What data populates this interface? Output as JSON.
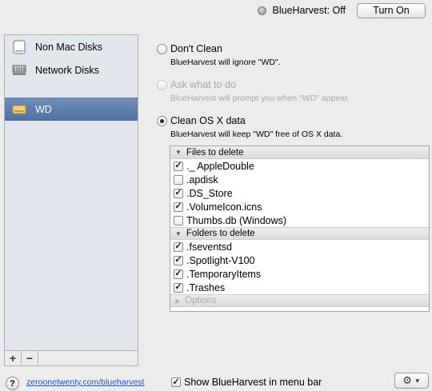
{
  "status": {
    "label": "BlueHarvest: Off",
    "button": "Turn On"
  },
  "sidebar": {
    "items": [
      {
        "label": "Non Mac Disks",
        "icon": "disk-icon"
      },
      {
        "label": "Network Disks",
        "icon": "network-icon"
      },
      {
        "label": "WD",
        "icon": "drive-icon",
        "selected": true
      }
    ],
    "add_label": "+",
    "remove_label": "−"
  },
  "options": {
    "dont_clean": {
      "label": "Don't Clean",
      "desc": "BlueHarvest will ignore \"WD\"."
    },
    "ask": {
      "label": "Ask what to do",
      "desc": "BlueHarvest will prompt you when \"WD\" appear."
    },
    "clean": {
      "label": "Clean OS X data",
      "desc": "BlueHarvest will keep \"WD\" free of OS X data."
    }
  },
  "list": {
    "files_header": "Files to delete",
    "files": [
      {
        "name": "._ AppleDouble",
        "checked": true
      },
      {
        "name": ".apdisk",
        "checked": false
      },
      {
        "name": ".DS_Store",
        "checked": true
      },
      {
        "name": ".VolumeIcon.icns",
        "checked": true
      },
      {
        "name": "Thumbs.db (Windows)",
        "checked": false
      }
    ],
    "folders_header": "Folders to delete",
    "folders": [
      {
        "name": ".fseventsd",
        "checked": true
      },
      {
        "name": ".Spotlight-V100",
        "checked": true
      },
      {
        "name": ".TemporaryItems",
        "checked": true
      },
      {
        "name": ".Trashes",
        "checked": true
      }
    ],
    "options_header": "Options"
  },
  "footer": {
    "help": "?",
    "link": "zeroonetwenty.com/blueharvest",
    "menu_bar_option": "Show BlueHarvest in menu bar",
    "menu_bar_checked": true
  }
}
